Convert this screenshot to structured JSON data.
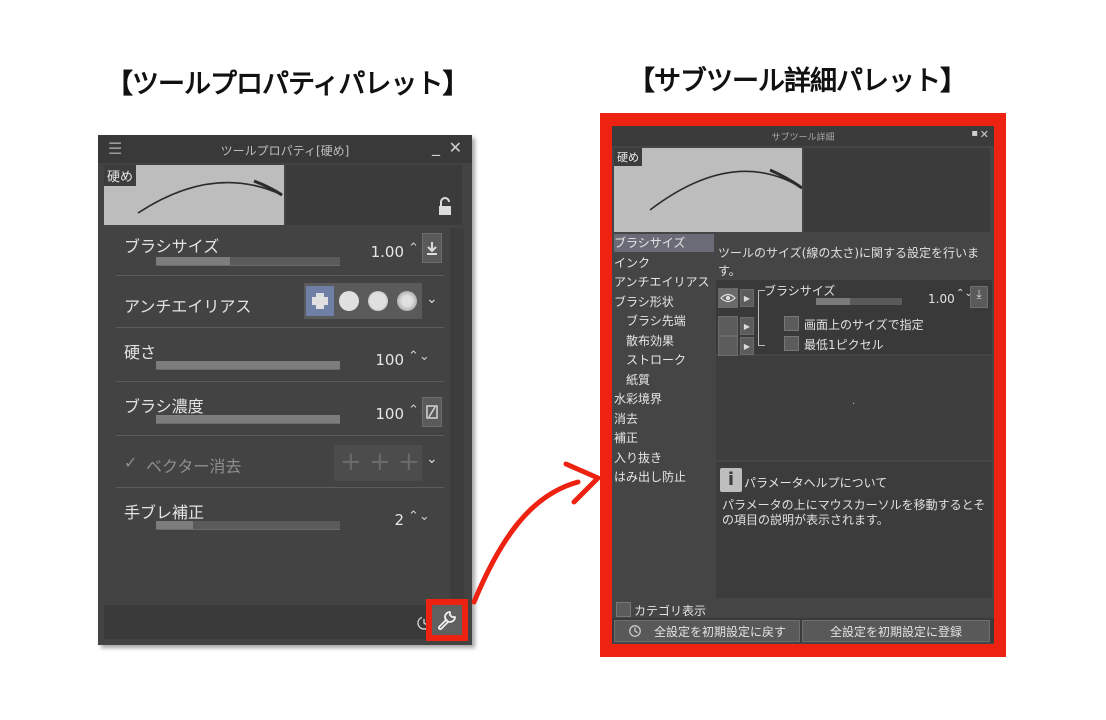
{
  "headings": {
    "left": "【ツールプロパティパレット】",
    "right": "【サブツール詳細パレット】"
  },
  "tool_property": {
    "title": "ツールプロパティ[硬め]",
    "menu_icon": "menu-icon",
    "preview_tag": "硬め",
    "rows": {
      "brush_size": {
        "label": "ブラシサイズ",
        "value": "1.00",
        "level": 0.4
      },
      "antialias": {
        "label": "アンチエイリアス"
      },
      "hardness": {
        "label": "硬さ",
        "value": "100",
        "level": 1.0
      },
      "density": {
        "label": "ブラシ濃度",
        "value": "100",
        "level": 1.0
      },
      "vector_erase": {
        "label": "ベクター消去",
        "check": "✓"
      },
      "stabilization": {
        "label": "手ブレ補正",
        "value": "2",
        "level": 0.2
      }
    },
    "icons": {
      "lock": "unlock-icon",
      "download": "download-icon",
      "pressure": "pressure-slash-icon",
      "wrench": "wrench-icon",
      "reset": "reset-clock-icon"
    },
    "glyphs": {
      "stepper": "⌃⌄",
      "caret": "⌄",
      "minimize": "_",
      "close": "✕",
      "plus": "+"
    }
  },
  "subtool_detail": {
    "title": "サブツール詳細",
    "preview_tag": "硬め",
    "categories": [
      {
        "label": "ブラシサイズ",
        "sub": false,
        "selected": true
      },
      {
        "label": "インク",
        "sub": false
      },
      {
        "label": "アンチエイリアス",
        "sub": false
      },
      {
        "label": "ブラシ形状",
        "sub": false
      },
      {
        "label": "ブラシ先端",
        "sub": true
      },
      {
        "label": "散布効果",
        "sub": true
      },
      {
        "label": "ストローク",
        "sub": true
      },
      {
        "label": "紙質",
        "sub": true
      },
      {
        "label": "水彩境界",
        "sub": false
      },
      {
        "label": "消去",
        "sub": false
      },
      {
        "label": "補正",
        "sub": false
      },
      {
        "label": "入り抜き",
        "sub": false
      },
      {
        "label": "はみ出し防止",
        "sub": false
      }
    ],
    "description": "ツールのサイズ(線の太さ)に関する設定を行います。",
    "brush_size_label": "ブラシサイズ",
    "brush_size_value": "1.00",
    "option_screen_size": "画面上のサイズで指定",
    "option_min_pixel": "最低1ピクセル",
    "help_title": "パラメータヘルプについて",
    "help_text": "パラメータの上にマウスカーソルを移動するとその項目の説明が表示されます。",
    "category_toggle": "カテゴリ表示",
    "reset_button": "全設定を初期設定に戻す",
    "register_button": "全設定を初期設定に登録",
    "glyphs": {
      "pin": "▪",
      "close": "✕",
      "play": "▶",
      "stepper": "⌃⌄",
      "download": "⤓",
      "dot": "."
    }
  },
  "colors": {
    "highlight": "#ee2211",
    "selected_category": "#6b6b78",
    "antialias_active": "#6f7fa6"
  }
}
